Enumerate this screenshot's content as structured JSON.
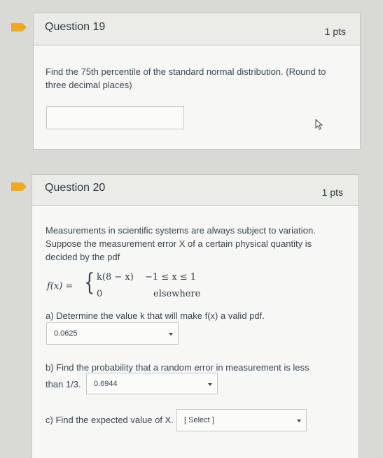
{
  "question19": {
    "title": "Question 19",
    "points": "1 pts",
    "text": "Find the 75th percentile of the standard normal distribution. (Round to three decimal places)",
    "answer_value": ""
  },
  "question20": {
    "title": "Question 20",
    "points": "1 pts",
    "intro": "Measurements in scientific systems are always subject to variation. Suppose the measurement error X of a certain physical quantity is decided by the pdf",
    "formula": {
      "lhs": "f(x) =",
      "case1_expr": "k(8 − x)",
      "case1_cond": "−1 ≤ x ≤ 1",
      "case2_expr": "0",
      "case2_cond": "elsewhere"
    },
    "part_a": {
      "text": "a) Determine the value k that will make f(x) a valid pdf.",
      "selected": "0.0625"
    },
    "part_b": {
      "text_line1": "b) Find the probability that a random error in measurement is less",
      "text_line2": "than 1/3.",
      "selected": "0.6944"
    },
    "part_c": {
      "text": "c) Find the expected value of X.",
      "selected": "[ Select ]"
    }
  },
  "colors": {
    "flag": "#f0a81c",
    "header_bg": "#ebebe8",
    "card_bg": "#f7f7f5"
  }
}
